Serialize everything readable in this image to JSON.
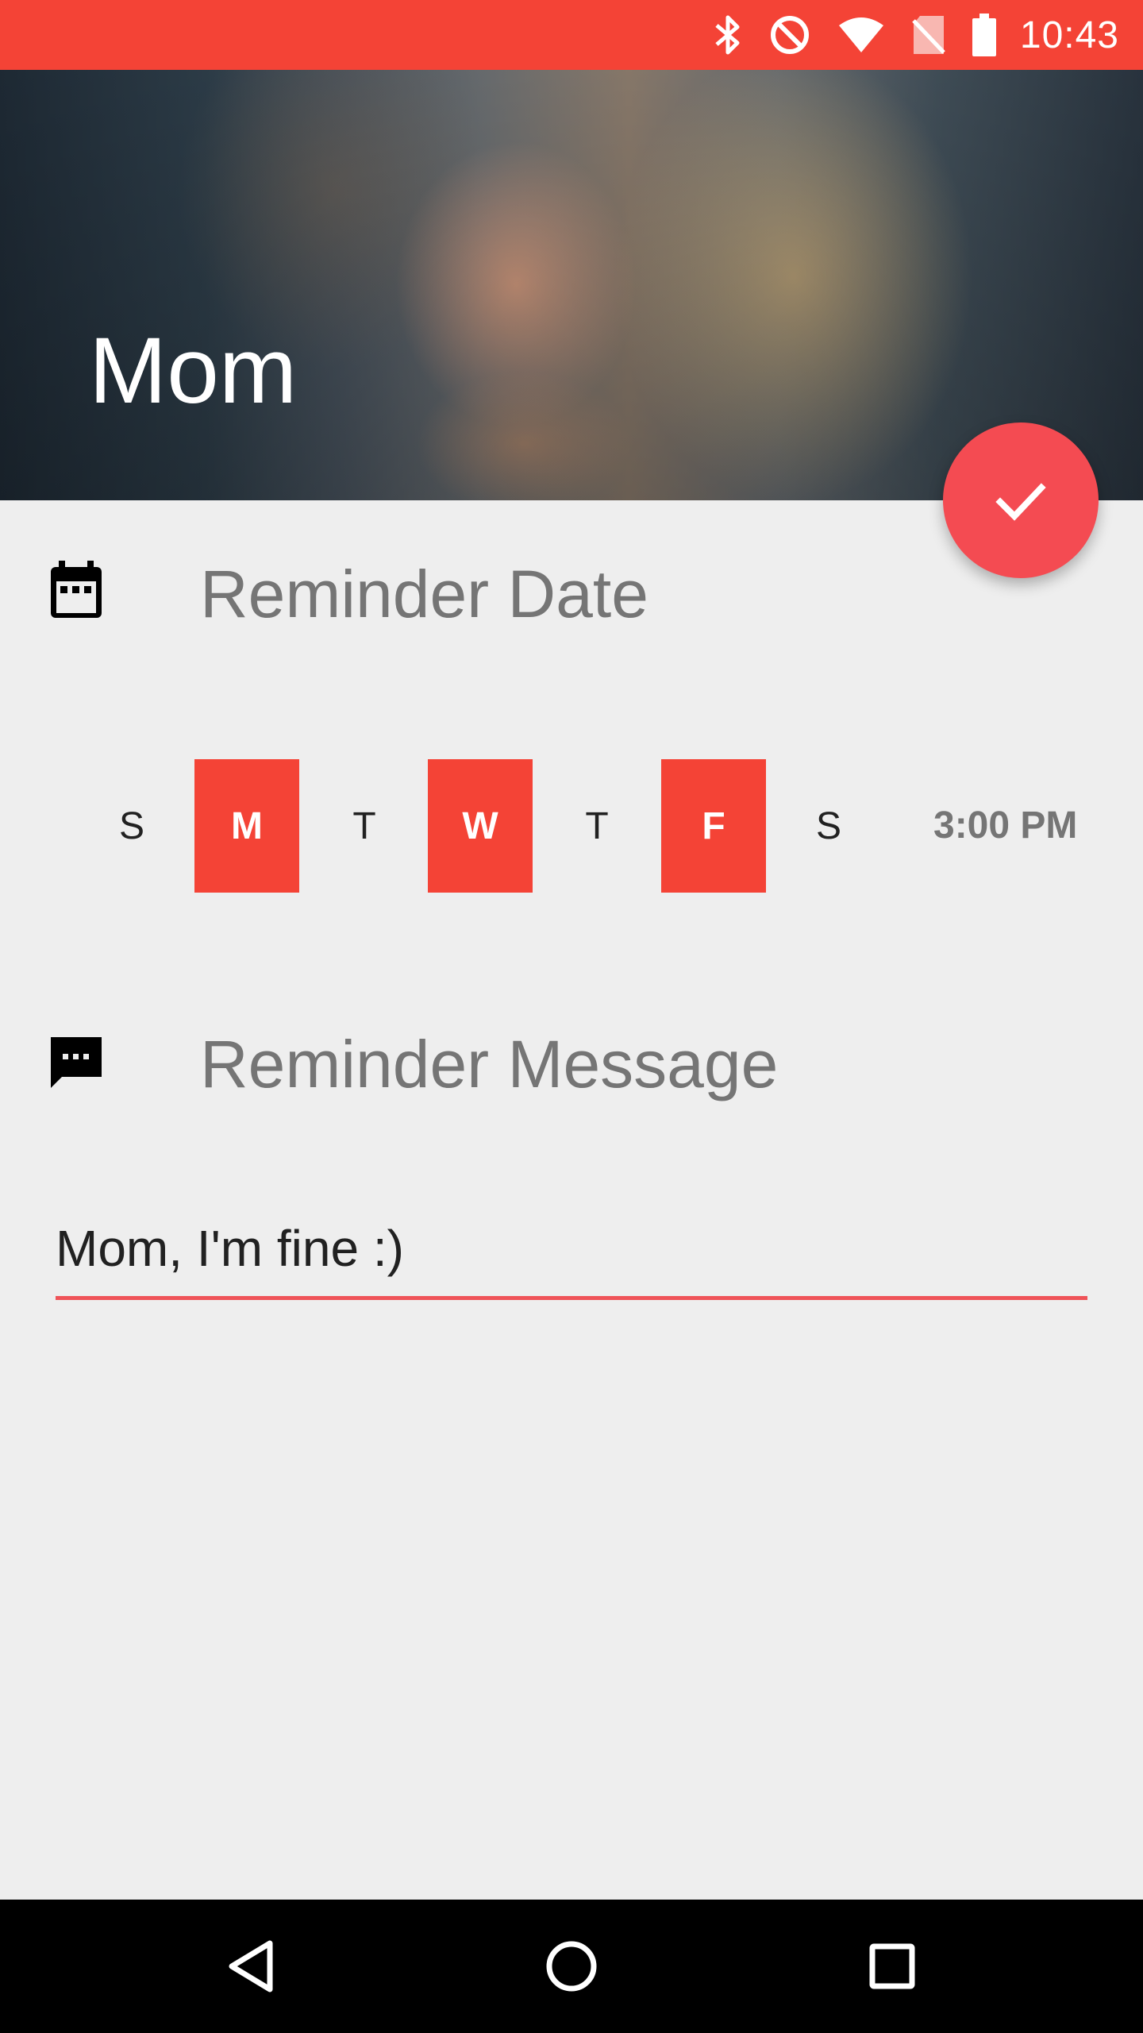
{
  "status_bar": {
    "time": "10:43",
    "icons": [
      "bluetooth-icon",
      "do-not-disturb-icon",
      "wifi-icon",
      "no-sim-icon",
      "battery-icon"
    ]
  },
  "header": {
    "title": "Mom"
  },
  "fab": {
    "icon": "check-icon"
  },
  "reminder_date": {
    "icon": "calendar-icon",
    "label": "Reminder Date",
    "days": [
      {
        "label": "S",
        "selected": false
      },
      {
        "label": "M",
        "selected": true
      },
      {
        "label": "T",
        "selected": false
      },
      {
        "label": "W",
        "selected": true
      },
      {
        "label": "T",
        "selected": false
      },
      {
        "label": "F",
        "selected": true
      },
      {
        "label": "S",
        "selected": false
      }
    ],
    "time": "3:00 PM"
  },
  "reminder_message": {
    "icon": "message-icon",
    "label": "Reminder Message",
    "value": "Mom, I'm fine :)"
  },
  "nav_bar": {
    "icons": [
      "back-icon",
      "home-icon",
      "recents-icon"
    ]
  },
  "colors": {
    "accent": "#f44336",
    "fab": "#f44b52",
    "underline": "#ef5358",
    "background": "#eeeeee"
  }
}
